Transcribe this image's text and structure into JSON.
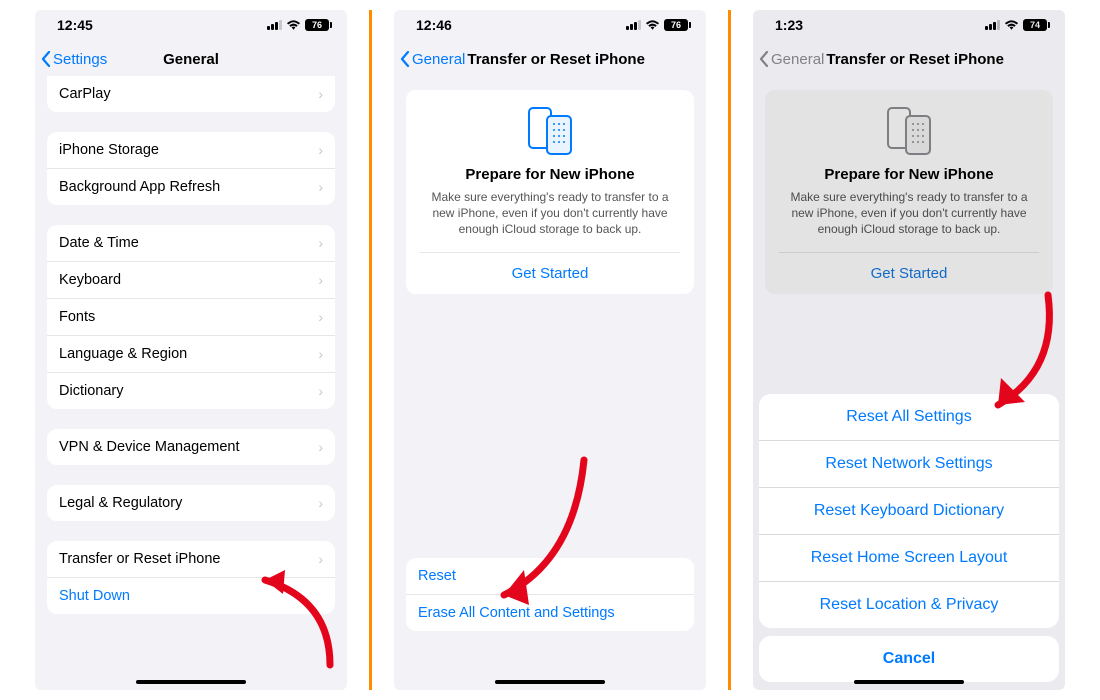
{
  "colors": {
    "accent": "#007aff",
    "arrow": "#e3051b",
    "divider": "#ff8c00"
  },
  "screen1": {
    "time": "12:45",
    "battery": "76",
    "back": "Settings",
    "title": "General",
    "rows": {
      "carplay": "CarPlay",
      "storage": "iPhone Storage",
      "background_refresh": "Background App Refresh",
      "date_time": "Date & Time",
      "keyboard": "Keyboard",
      "fonts": "Fonts",
      "language_region": "Language & Region",
      "dictionary": "Dictionary",
      "vpn": "VPN & Device Management",
      "legal": "Legal & Regulatory",
      "transfer_reset": "Transfer or Reset iPhone",
      "shutdown": "Shut Down"
    }
  },
  "screen2": {
    "time": "12:46",
    "battery": "76",
    "back": "General",
    "title": "Transfer or Reset iPhone",
    "card_title": "Prepare for New iPhone",
    "card_body": "Make sure everything's ready to transfer to a new iPhone, even if you don't currently have enough iCloud storage to back up.",
    "get_started": "Get Started",
    "rows": {
      "reset": "Reset",
      "erase": "Erase All Content and Settings"
    }
  },
  "screen3": {
    "time": "1:23",
    "battery": "74",
    "back": "General",
    "title": "Transfer or Reset iPhone",
    "card_title": "Prepare for New iPhone",
    "card_body": "Make sure everything's ready to transfer to a new iPhone, even if you don't currently have enough iCloud storage to back up.",
    "get_started": "Get Started",
    "options": [
      "Reset All Settings",
      "Reset Network Settings",
      "Reset Keyboard Dictionary",
      "Reset Home Screen Layout",
      "Reset Location & Privacy"
    ],
    "cancel": "Cancel"
  }
}
